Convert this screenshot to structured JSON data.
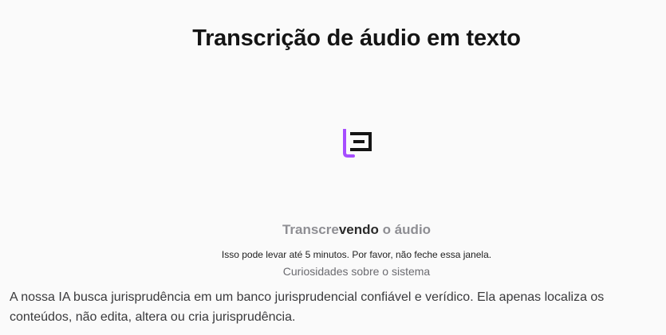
{
  "header": {
    "title": "Transcrição de áudio em texto"
  },
  "logo": {
    "icon": "brand-logo-icon",
    "accent_color": "#a64dff",
    "dark_color": "#141414"
  },
  "status": {
    "prefix": "Transcre",
    "highlight": "vendo",
    "suffix": " o áudio"
  },
  "notice": "Isso pode levar até 5 minutos. Por favor, não feche essa janela.",
  "curiosities": {
    "title": "Curiosidades sobre o sistema",
    "text": "A nossa IA busca jurisprudência em um banco jurisprudencial confiável e verídico. Ela apenas localiza os conteúdos, não edita, altera ou cria jurisprudência."
  }
}
